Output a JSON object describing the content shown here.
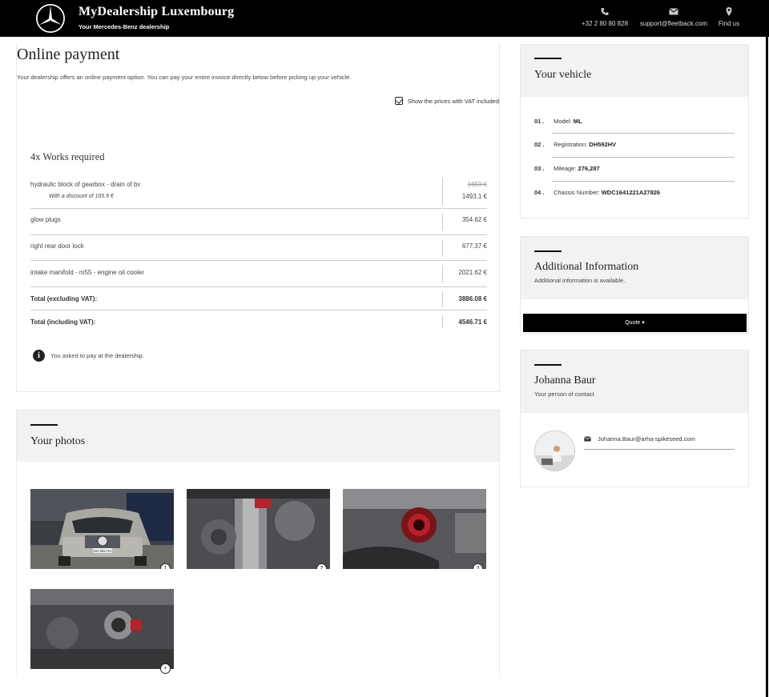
{
  "header": {
    "brand_title": "MyDealership Luxembourg",
    "brand_subtitle": "Your Mercedes-Benz dealership",
    "phone": "+32 2 80 80 828",
    "email": "support@fleetback.com",
    "find_us": "Find us"
  },
  "payment": {
    "title": "Online payment",
    "intro": "Your dealership offers an online payment option. You can pay your entire invoice directly below before picking up your vehicle.",
    "vat_toggle_label": "Show the prices with VAT included",
    "vat_checked": true,
    "works_title": "4x Works required",
    "items": [
      {
        "description": "hydraulic block of gearbox - drain of bv",
        "old_price": "1659 €",
        "discount_note": "With a discount of 165.9 €",
        "price": "1493.1 €"
      },
      {
        "description": "glow plugs",
        "price": "354.62 €"
      },
      {
        "description": "right rear door lock",
        "price": "677.37 €"
      },
      {
        "description": "intake manifold - m55 - engine oil cooler",
        "price": "2021.62 €"
      }
    ],
    "total_excl_label": "Total (excluding VAT):",
    "total_excl_value": "3886.08 €",
    "total_incl_label": "Total (including VAT):",
    "total_incl_value": "4546.71 €",
    "info_message": "You asked to pay at the dealership."
  },
  "photos": {
    "title": "Your photos",
    "numbers": [
      "1",
      "2",
      "3",
      "+"
    ]
  },
  "vehicle": {
    "title": "Your vehicle",
    "rows": [
      {
        "num": "01 .",
        "label": "Model:",
        "value": "ML"
      },
      {
        "num": "02 .",
        "label": "Registration:",
        "value": "DH592HV"
      },
      {
        "num": "03 .",
        "label": "Mileage:",
        "value": "276,287"
      },
      {
        "num": "04 .",
        "label": "Chassis Number:",
        "value": "WDC1641221A27826"
      }
    ]
  },
  "additional": {
    "title": "Additional Information",
    "subtitle": "Additional information is available.",
    "quote_button": "Quote ▾"
  },
  "contact": {
    "name": "Johanna Baur",
    "subtitle": "Your person of contact",
    "email": "Johanna.Baur@arha-spikeseed.com"
  },
  "photo1_plate": "DH 592 HV",
  "colors": {
    "topbar": "#000000",
    "panel_head": "#f2f2f2",
    "engine_red": "#b8202a"
  }
}
